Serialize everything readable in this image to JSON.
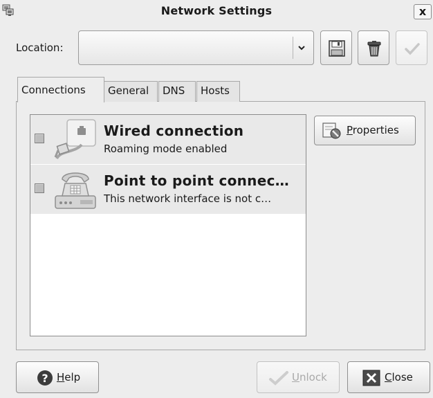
{
  "window": {
    "title": "Network Settings",
    "close_label": "x"
  },
  "location": {
    "label": "Location:",
    "value": ""
  },
  "toolbar": {
    "save_icon": "floppy-disk-icon",
    "delete_icon": "trash-can-icon",
    "apply_icon": "checkmark-icon"
  },
  "tabs": [
    {
      "label": "Connections",
      "active": true
    },
    {
      "label": "General",
      "active": false
    },
    {
      "label": "DNS",
      "active": false
    },
    {
      "label": "Hosts",
      "active": false
    }
  ],
  "connections": [
    {
      "name": "Wired connection",
      "status": "Roaming mode enabled",
      "icon": "ethernet-icon",
      "checked": false
    },
    {
      "name": "Point to point connec…",
      "status": "This network interface is not c…",
      "icon": "telephone-modem-icon",
      "checked": false
    }
  ],
  "properties_button": {
    "mnemonic": "P",
    "rest": "roperties"
  },
  "footer": {
    "help": {
      "mnemonic": "H",
      "rest": "elp"
    },
    "unlock": {
      "mnemonic": "U",
      "rest": "nlock",
      "enabled": false
    },
    "close": {
      "mnemonic": "C",
      "rest": "lose"
    }
  },
  "colors": {
    "window_bg": "#ededed",
    "row_bg": "#e9e9e9",
    "list_bg": "#ffffff",
    "disabled_text": "#a9a9a9"
  }
}
